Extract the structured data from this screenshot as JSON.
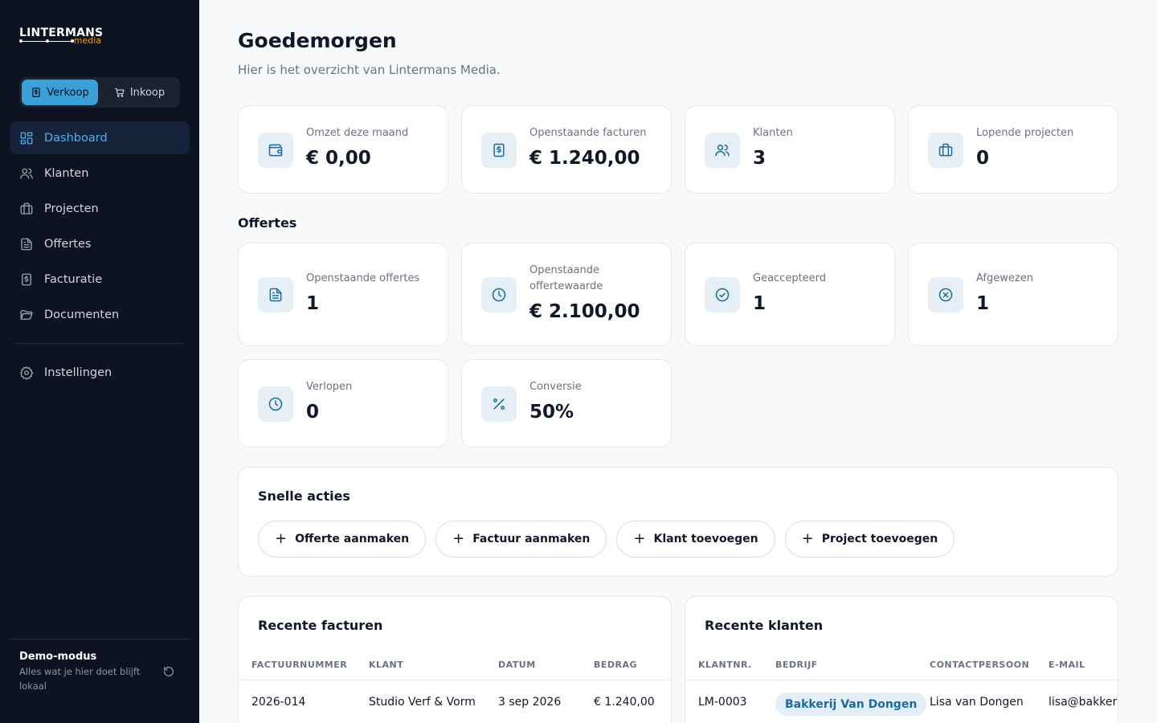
{
  "brand": {
    "name": "LINTERMANS",
    "sub": "media"
  },
  "mode_switch": {
    "sales": "Verkoop",
    "purchase": "Inkoop"
  },
  "nav": {
    "dashboard": "Dashboard",
    "clients": "Klanten",
    "projects": "Projecten",
    "quotes": "Offertes",
    "invoicing": "Facturatie",
    "documents": "Documenten",
    "settings": "Instellingen"
  },
  "demo": {
    "title": "Demo-modus",
    "text": "Alles wat je hier doet blijft lokaal"
  },
  "header": {
    "title": "Goedemorgen",
    "subtitle": "Hier is het overzicht van Lintermans Media."
  },
  "stats": [
    {
      "label": "Omzet deze maand",
      "value": "€ 0,00",
      "icon": "wallet-icon"
    },
    {
      "label": "Openstaande facturen",
      "value": "€ 1.240,00",
      "icon": "receipt-icon"
    },
    {
      "label": "Klanten",
      "value": "3",
      "icon": "users-icon"
    },
    {
      "label": "Lopende projecten",
      "value": "0",
      "icon": "briefcase-icon"
    }
  ],
  "quotes_section": {
    "title": "Offertes",
    "stats": [
      {
        "label": "Openstaande offertes",
        "value": "1",
        "icon": "document-icon"
      },
      {
        "label": "Openstaande offertewaarde",
        "value": "€ 2.100,00",
        "icon": "clock-icon"
      },
      {
        "label": "Geaccepteerd",
        "value": "1",
        "icon": "check-circle-icon"
      },
      {
        "label": "Afgewezen",
        "value": "1",
        "icon": "x-circle-icon"
      },
      {
        "label": "Verlopen",
        "value": "0",
        "icon": "clock-icon"
      },
      {
        "label": "Conversie",
        "value": "50%",
        "icon": "percent-icon"
      }
    ]
  },
  "quick_actions": {
    "title": "Snelle acties",
    "buttons": [
      "Offerte aanmaken",
      "Factuur aanmaken",
      "Klant toevoegen",
      "Project toevoegen"
    ]
  },
  "recent_invoices": {
    "title": "Recente facturen",
    "columns": [
      "FACTUURNUMMER",
      "KLANT",
      "DATUM",
      "BEDRAG"
    ],
    "rows": [
      [
        "2026-014",
        "Studio Verf & Vorm",
        "3 sep 2026",
        "€ 1.240,00"
      ]
    ]
  },
  "recent_clients": {
    "title": "Recente klanten",
    "columns": [
      "KLANTNR.",
      "BEDRIJF",
      "CONTACTPERSOON",
      "E-MAIL"
    ],
    "rows": [
      [
        "LM-0003",
        "Bakkerij Van Dongen",
        "Lisa van Dongen",
        "lisa@bakkeri"
      ]
    ]
  },
  "colors": {
    "sidebar": "#0d1321",
    "accent": "#3b9fd8",
    "icon_bg": "#e6eff6",
    "brand_sub": "#f59e0b"
  }
}
